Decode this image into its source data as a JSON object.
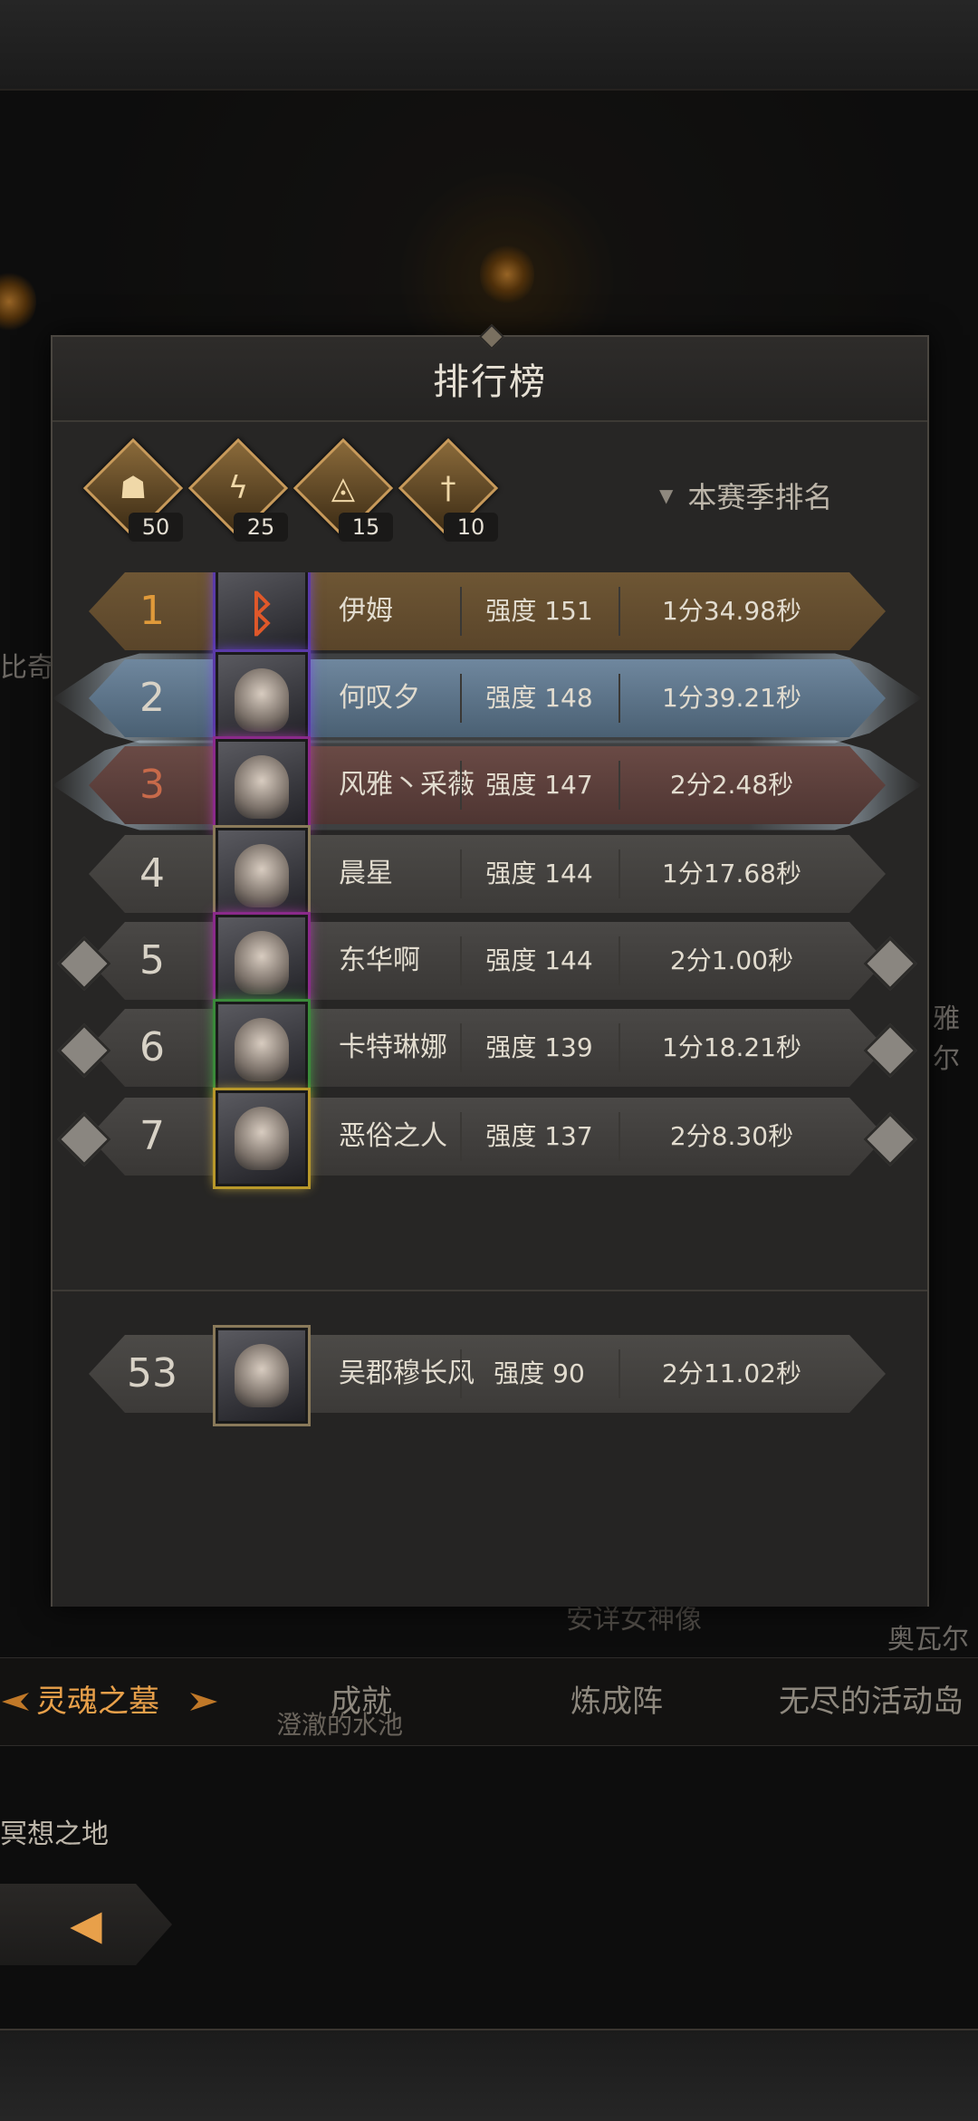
{
  "dialog": {
    "title": "排行榜"
  },
  "filters": [
    {
      "icon": "skull-banner-icon",
      "glyph": "☗",
      "count": "50"
    },
    {
      "icon": "lightning-icon",
      "glyph": "ϟ",
      "count": "25"
    },
    {
      "icon": "eye-triangle-icon",
      "glyph": "◬",
      "count": "15"
    },
    {
      "icon": "sword-icon",
      "glyph": "†",
      "count": "10"
    }
  ],
  "season_select": {
    "label": "本赛季排名"
  },
  "rankings": [
    {
      "rank": "1",
      "name": "伊姆",
      "power": "强度 151",
      "time": "1分34.98秒",
      "style": "gold"
    },
    {
      "rank": "2",
      "name": "何叹夕",
      "power": "强度 148",
      "time": "1分39.21秒",
      "style": "blue"
    },
    {
      "rank": "3",
      "name": "风雅丶采薇",
      "power": "强度 147",
      "time": "2分2.48秒",
      "style": "red"
    },
    {
      "rank": "4",
      "name": "晨星",
      "power": "强度 144",
      "time": "1分17.68秒",
      "style": "gray"
    },
    {
      "rank": "5",
      "name": "东华啊",
      "power": "强度 144",
      "time": "2分1.00秒",
      "style": "iron"
    },
    {
      "rank": "6",
      "name": "卡特琳娜",
      "power": "强度 139",
      "time": "1分18.21秒",
      "style": "iron"
    },
    {
      "rank": "7",
      "name": "恶俗之人",
      "power": "强度 137",
      "time": "2分8.30秒",
      "style": "iron"
    }
  ],
  "my_rank": {
    "rank": "53",
    "name": "吴郡穆长风",
    "power": "强度 90",
    "time": "2分11.02秒"
  },
  "tabs": [
    "灵魂之墓",
    "成就",
    "炼成阵",
    "无尽的活动岛"
  ],
  "background_labels": {
    "left_cut": "比奇",
    "right_cut": "雅尔",
    "statue": "安详女神像",
    "pool": "澄澈的水池",
    "right_place": "奥瓦尔",
    "meditation": "冥想之地"
  }
}
